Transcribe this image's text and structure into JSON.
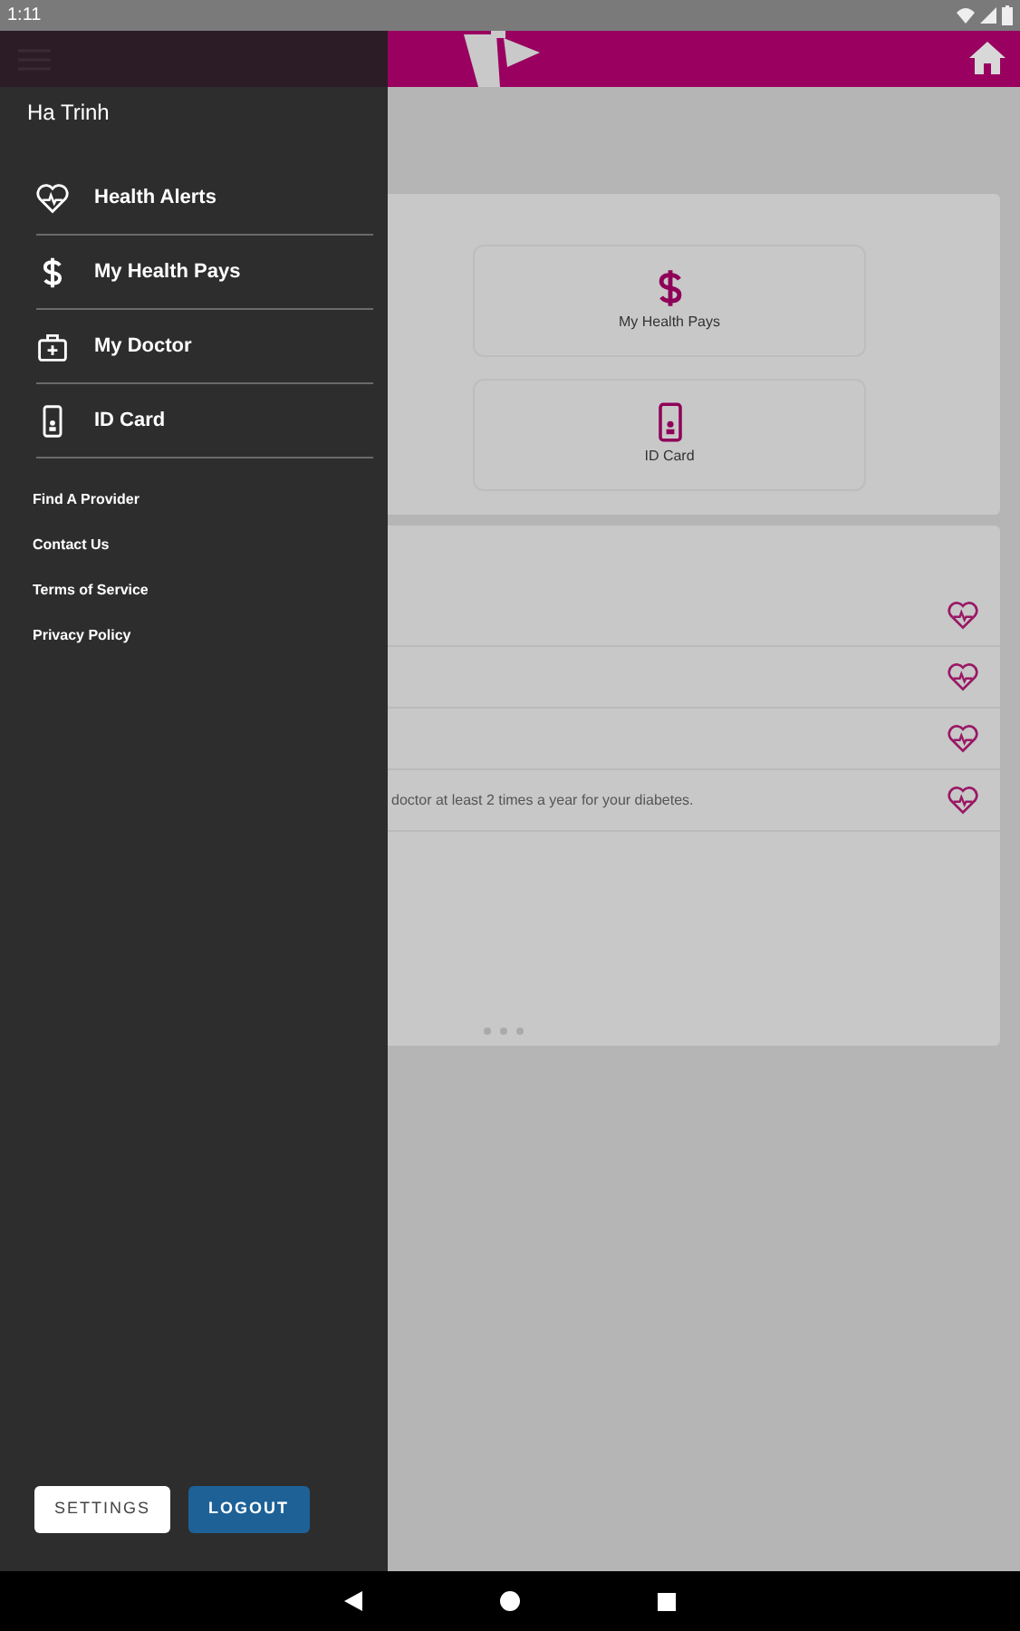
{
  "status_bar": {
    "time": "1:11"
  },
  "tiles": [
    {
      "label": "My Health Pays",
      "kind": "dollar"
    },
    {
      "label": "ID Card",
      "kind": "idcard"
    }
  ],
  "alerts": [
    {
      "kind": "covered"
    },
    {
      "kind": "covered"
    },
    {
      "kind": "covered"
    },
    {
      "kind": "text",
      "text": "doctor at least 2 times a year for your diabetes."
    }
  ],
  "drawer": {
    "user_name": "Ha Trinh",
    "items": [
      {
        "label": "Health Alerts",
        "kind": "heart"
      },
      {
        "label": "My Health Pays",
        "kind": "dollar"
      },
      {
        "label": "My Doctor",
        "kind": "doctor"
      },
      {
        "label": "ID Card",
        "kind": "idcard"
      }
    ],
    "links": [
      "Find A Provider",
      "Contact Us",
      "Terms of Service",
      "Privacy Policy"
    ],
    "buttons": [
      {
        "label": "SETTINGS",
        "kind": "outline"
      },
      {
        "label": "LOGOUT",
        "kind": "primary"
      }
    ]
  }
}
